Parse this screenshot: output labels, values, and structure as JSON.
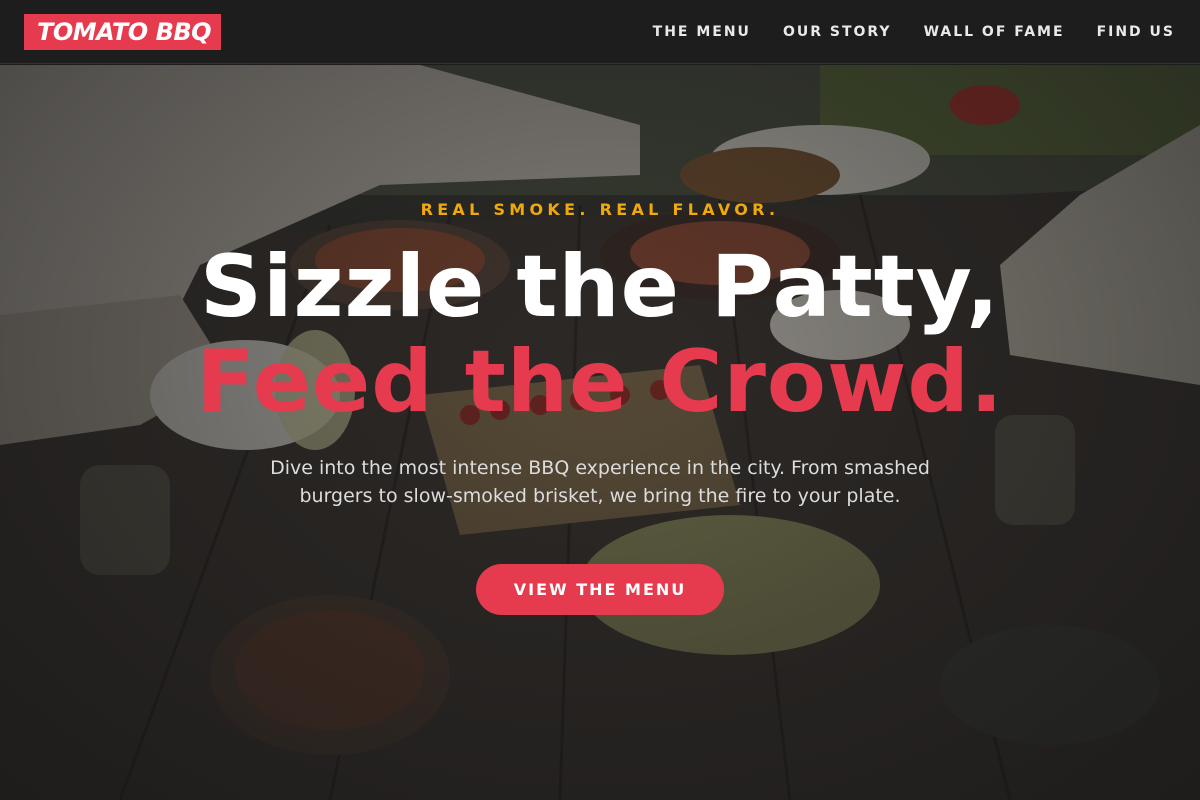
{
  "brand": {
    "logo_text": "TOMATO BBQ",
    "accent_color": "#e63b4f",
    "highlight_color": "#f1a80c"
  },
  "nav": {
    "items": [
      {
        "label": "THE MENU"
      },
      {
        "label": "OUR STORY"
      },
      {
        "label": "WALL OF FAME"
      },
      {
        "label": "FIND US"
      }
    ]
  },
  "hero": {
    "eyebrow": "REAL SMOKE. REAL FLAVOR.",
    "headline_line1": "Sizzle the Patty,",
    "headline_line2": "Feed the Crowd.",
    "description": "Dive into the most intense BBQ experience in the city. From smashed burgers to slow-smoked brisket, we bring the fire to your plate.",
    "cta_label": "VIEW THE MENU",
    "background_image": "bbq-table-photo"
  }
}
